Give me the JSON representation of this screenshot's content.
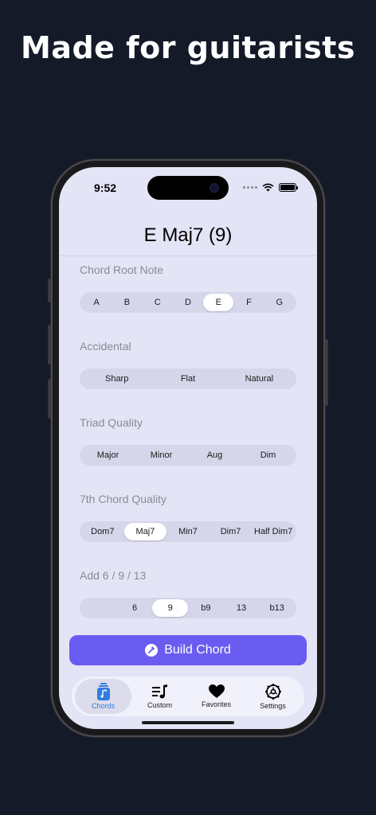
{
  "headline": "Made for guitarists",
  "status": {
    "time": "9:52"
  },
  "title": "E Maj7 (9)",
  "sections": [
    {
      "label": "Chord Root Note",
      "options": [
        "A",
        "B",
        "C",
        "D",
        "E",
        "F",
        "G"
      ],
      "selected": "E"
    },
    {
      "label": "Accidental",
      "options": [
        "Sharp",
        "Flat",
        "Natural"
      ],
      "selected": ""
    },
    {
      "label": "Triad Quality",
      "options": [
        "Major",
        "Minor",
        "Aug",
        "Dim"
      ],
      "selected": ""
    },
    {
      "label": "7th Chord Quality",
      "options": [
        "Dom7",
        "Maj7",
        "Min7",
        "Dim7",
        "Half Dim7"
      ],
      "selected": "Maj7"
    },
    {
      "label": "Add 6 / 9 / 13",
      "options": [
        "",
        "6",
        "9",
        "b9",
        "13",
        "b13"
      ],
      "selected": "9"
    }
  ],
  "build_button": {
    "label": "Build Chord",
    "icon": "hammer-icon"
  },
  "tabs": [
    {
      "label": "Chords",
      "icon": "music-note-icon",
      "active": true
    },
    {
      "label": "Custom",
      "icon": "playlist-icon",
      "active": false
    },
    {
      "label": "Favorites",
      "icon": "heart-icon",
      "active": false
    },
    {
      "label": "Settings",
      "icon": "gear-icon",
      "active": false
    }
  ],
  "colors": {
    "accent": "#6a5cf0",
    "tab_active": "#2f7de1",
    "background": "#141a28",
    "screen": "#e4e4f7"
  }
}
